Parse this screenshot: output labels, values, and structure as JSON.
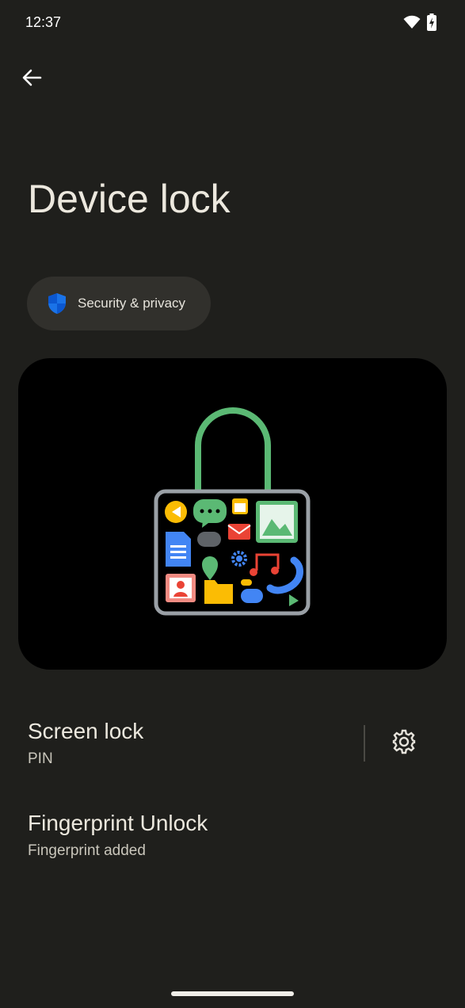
{
  "status_bar": {
    "time": "12:37",
    "icons": [
      "wifi-icon",
      "battery-charging-icon"
    ]
  },
  "nav": {
    "back_icon": "arrow-left-icon"
  },
  "page": {
    "title": "Device lock"
  },
  "chip": {
    "label": "Security & privacy",
    "icon": "shield-icon",
    "icon_color": "#1a73e8"
  },
  "illustration": {
    "subject": "padlock-with-app-icons"
  },
  "preferences": [
    {
      "title": "Screen lock",
      "summary": "PIN",
      "action_icon": "gear-icon"
    },
    {
      "title": "Fingerprint Unlock",
      "summary": "Fingerprint added"
    }
  ],
  "colors": {
    "background": "#1f1f1c",
    "card": "#31302c",
    "text": "#ece8de",
    "shackle": "#5bb974"
  }
}
